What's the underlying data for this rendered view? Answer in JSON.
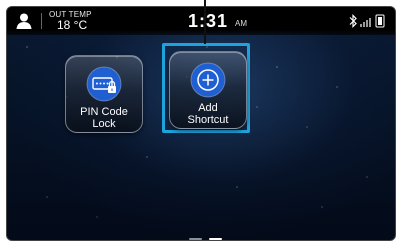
{
  "status_bar": {
    "temp_label": "OUT TEMP",
    "temp_value": "18 °C",
    "time": "1:31",
    "ampm": "AM",
    "icons": [
      "user-icon",
      "bluetooth-icon",
      "signal-icon",
      "battery-icon"
    ]
  },
  "home": {
    "tiles": [
      {
        "label_line1": "PIN Code",
        "label_line2": "Lock",
        "icon": "pin-code-lock-icon",
        "icon_color": "#1f5fd1"
      },
      {
        "label_line1": "Add",
        "label_line2": "Shortcut",
        "icon": "add-plus-icon",
        "icon_color": "#1f5fd1",
        "focused": true
      }
    ],
    "focus_color": "#1ea3dc"
  },
  "pagination": {
    "total": 2,
    "current": 2
  }
}
